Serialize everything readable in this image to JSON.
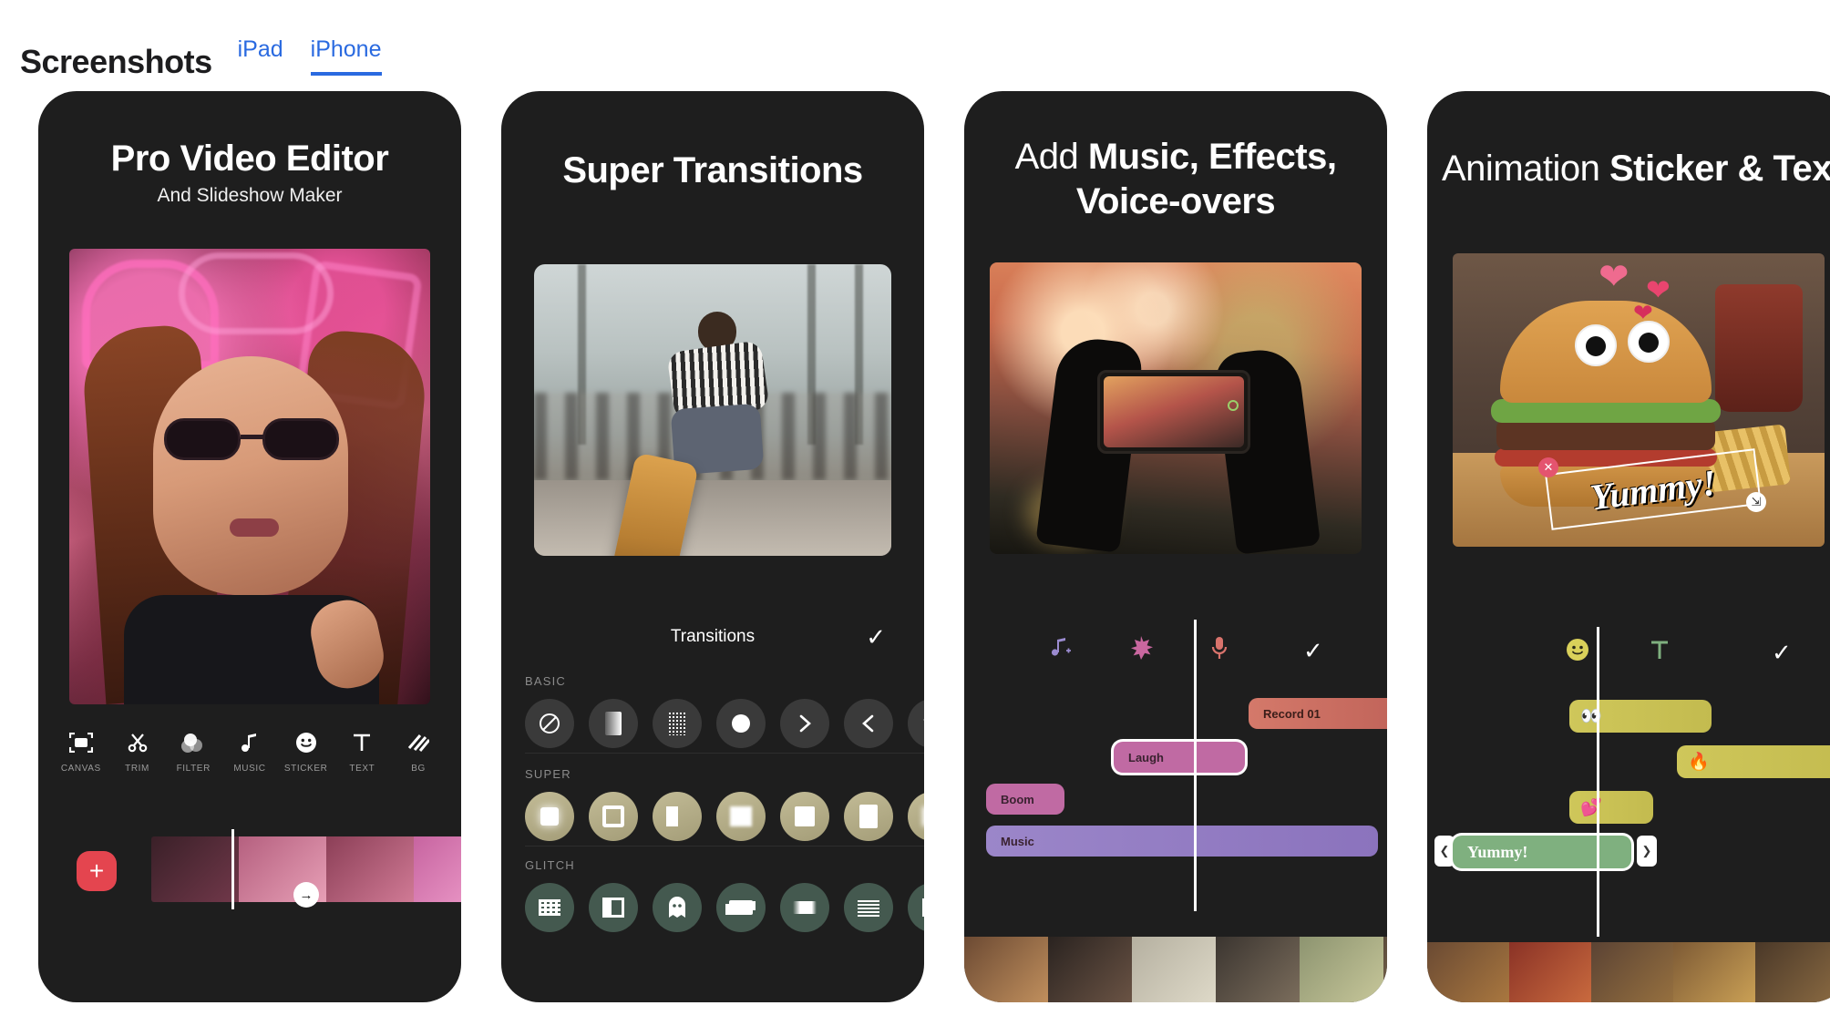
{
  "header": {
    "title": "Screenshots",
    "tabs": [
      {
        "label": "iPad",
        "active": false
      },
      {
        "label": "iPhone",
        "active": true
      }
    ]
  },
  "accent_color": "#2a6ae0",
  "phone_bg": "#1e1e1e",
  "screens": [
    {
      "title_regular": "",
      "title_bold": "Pro Video Editor",
      "subtitle": "And Slideshow Maker",
      "toolbar": [
        {
          "label": "CANVAS",
          "icon": "canvas-icon"
        },
        {
          "label": "TRIM",
          "icon": "scissors-icon"
        },
        {
          "label": "FILTER",
          "icon": "filter-circles-icon"
        },
        {
          "label": "MUSIC",
          "icon": "music-note-icon"
        },
        {
          "label": "STICKER",
          "icon": "smiley-icon"
        },
        {
          "label": "TEXT",
          "icon": "text-t-icon"
        },
        {
          "label": "BG",
          "icon": "hatch-lines-icon"
        }
      ],
      "add_button_label": "+",
      "transition_badge_icon": "arrow-right-icon"
    },
    {
      "title_regular": "",
      "title_bold": "Super Transitions",
      "panel_title": "Transitions",
      "confirm_icon": "checkmark-icon",
      "sections": [
        {
          "label": "BASIC",
          "style": "basic",
          "icons": [
            "none-slash-icon",
            "fade-icon",
            "dither-icon",
            "circle-icon",
            "chevron-right-icon",
            "chevron-left-icon",
            "chevron-down-icon"
          ]
        },
        {
          "label": "SUPER",
          "style": "super",
          "icons": [
            "zoom-in-icon",
            "frame-icon",
            "split-left-icon",
            "blur-box-icon",
            "square-icon",
            "wipe-icon",
            "soft-icon"
          ]
        },
        {
          "label": "GLITCH",
          "style": "glitch",
          "icons": [
            "pixel-glitch-icon",
            "split-panel-icon",
            "ghost-icon",
            "shake-icon",
            "smear-icon",
            "scanline-icon",
            "fade-block-icon"
          ]
        }
      ]
    },
    {
      "title_regular": "Add ",
      "title_bold": "Music, Effects,",
      "title_line2_bold": "Voice-overs",
      "icons": [
        {
          "name": "add-music-icon",
          "glyph": "♪",
          "color": "#9b8bd0"
        },
        {
          "name": "effects-burst-icon",
          "glyph": "✸",
          "color": "#c濃"
        },
        {
          "name": "voice-record-icon",
          "glyph": "\u0000",
          "color": "#d9736c"
        },
        {
          "name": "checkmark-icon",
          "glyph": "✓",
          "color": "#ffffff"
        }
      ],
      "clips": [
        {
          "label": "Record 01",
          "color": "#cd6a5c",
          "selected": false
        },
        {
          "label": "Laugh",
          "color": "#c06aa3",
          "selected": true
        },
        {
          "label": "Boom",
          "color": "#c06aa3",
          "selected": false
        },
        {
          "label": "Music",
          "color": "#9b86c9",
          "selected": false
        }
      ]
    },
    {
      "title_regular": "Animation ",
      "title_bold": "Sticker & Text",
      "icons": [
        {
          "name": "sticker-smiley-icon",
          "glyph": "🙂",
          "color": "#d9d05a"
        },
        {
          "name": "text-t-icon",
          "glyph": "T",
          "color": "#7fb07f"
        },
        {
          "name": "checkmark-icon",
          "glyph": "✓",
          "color": "#ffffff"
        }
      ],
      "sticker_clips": [
        {
          "emoji": "👀",
          "color": "#cfc75a"
        },
        {
          "emoji": "🔥",
          "color": "#cfc75a"
        },
        {
          "emoji": "💕",
          "color": "#cfc75a"
        }
      ],
      "text_clip": {
        "label": "Yummy!",
        "color": "#7fb07f"
      },
      "overlay_text": "Yummy!",
      "handle_left_icon": "chevron-left-icon",
      "handle_right_icon": "chevron-right-icon"
    }
  ]
}
